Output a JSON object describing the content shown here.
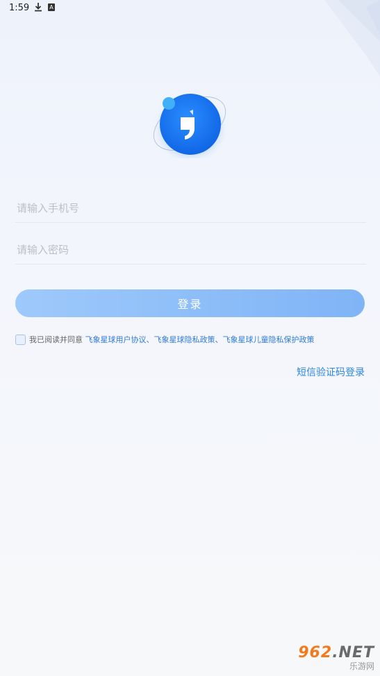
{
  "status": {
    "time": "1:59",
    "download_icon": "download-icon",
    "a_badge": "A"
  },
  "login": {
    "phone_placeholder": "请输入手机号",
    "password_placeholder": "请输入密码",
    "login_label": "登录",
    "agree_prefix": "我已阅读并同意",
    "agree_links": "飞象星球用户协议、飞象星球隐私政策、飞象星球儿童隐私保护政策",
    "sms_login": "短信验证码登录"
  },
  "watermark": {
    "main_a": "962",
    "main_b": ".NET",
    "sub": "乐游网"
  },
  "colors": {
    "primary": "#1976f2",
    "button": "#8dbdf8",
    "link": "#2f86e0"
  }
}
